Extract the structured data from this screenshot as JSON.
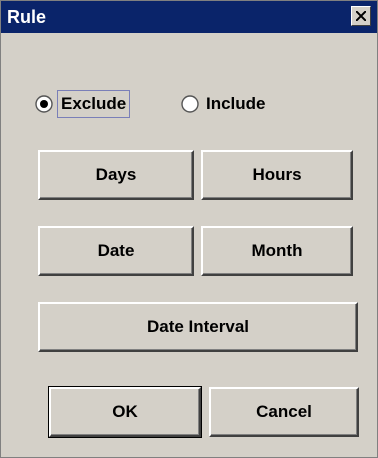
{
  "dialog": {
    "title": "Rule",
    "close_icon": "close-icon"
  },
  "mode": {
    "selected": "Exclude",
    "options": [
      {
        "label": "Exclude",
        "checked": true
      },
      {
        "label": "Include",
        "checked": false
      }
    ]
  },
  "buttons": {
    "days": "Days",
    "hours": "Hours",
    "date": "Date",
    "month": "Month",
    "date_interval": "Date Interval",
    "ok": "OK",
    "cancel": "Cancel"
  }
}
